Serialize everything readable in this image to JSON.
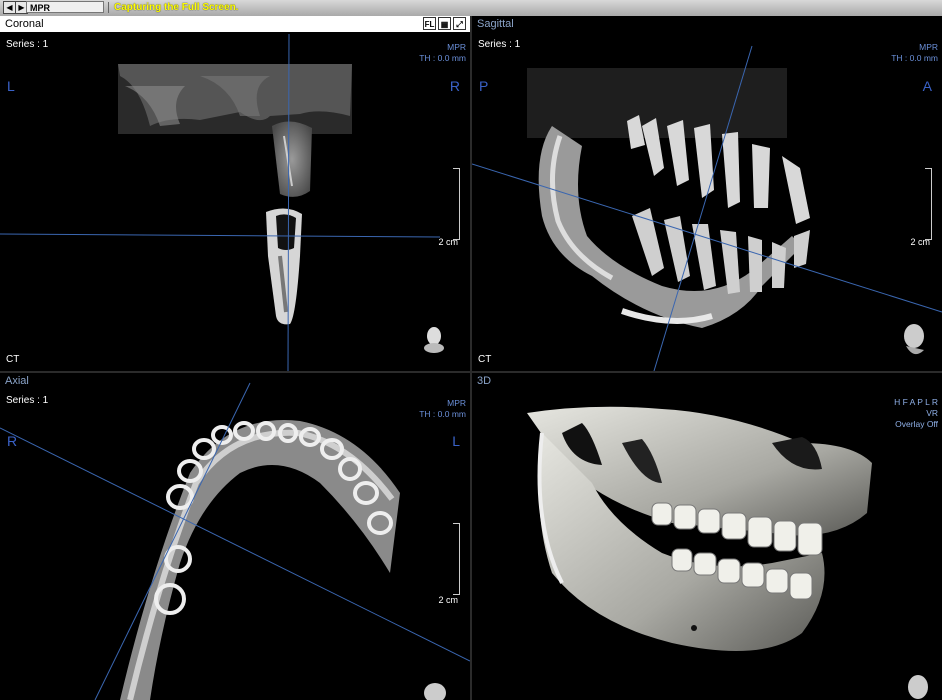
{
  "toolbar": {
    "prev_icon": "left-arrow",
    "next_icon": "right-arrow",
    "mode": "MPR",
    "status": "Capturing the Full Screen."
  },
  "coronal": {
    "title": "Coronal",
    "series": "Series : 1",
    "info": [
      "MPR",
      "TH : 0.0 mm"
    ],
    "left": "L",
    "right": "R",
    "modality": "CT",
    "scale": "2 cm",
    "icons": [
      "FL",
      "grid-icon",
      "maximize-icon"
    ]
  },
  "sagittal": {
    "title": "Sagittal",
    "series": "Series : 1",
    "info": [
      "MPR",
      "TH : 0.0 mm"
    ],
    "left": "P",
    "right": "A",
    "modality": "CT",
    "scale": "2 cm"
  },
  "axial": {
    "title": "Axial",
    "series": "Series : 1",
    "info": [
      "MPR",
      "TH : 0.0 mm"
    ],
    "left": "R",
    "right": "L",
    "scale": "2 cm"
  },
  "vr3d": {
    "title": "3D",
    "info": [
      "H F A P L R",
      "VR",
      "Overlay Off"
    ]
  },
  "colors": {
    "crosshair": "#3a66b0",
    "orient": "#3a62c8",
    "info": "#6a8fd8",
    "title_inactive": "#8aa3c8",
    "status": "#ffff00"
  }
}
